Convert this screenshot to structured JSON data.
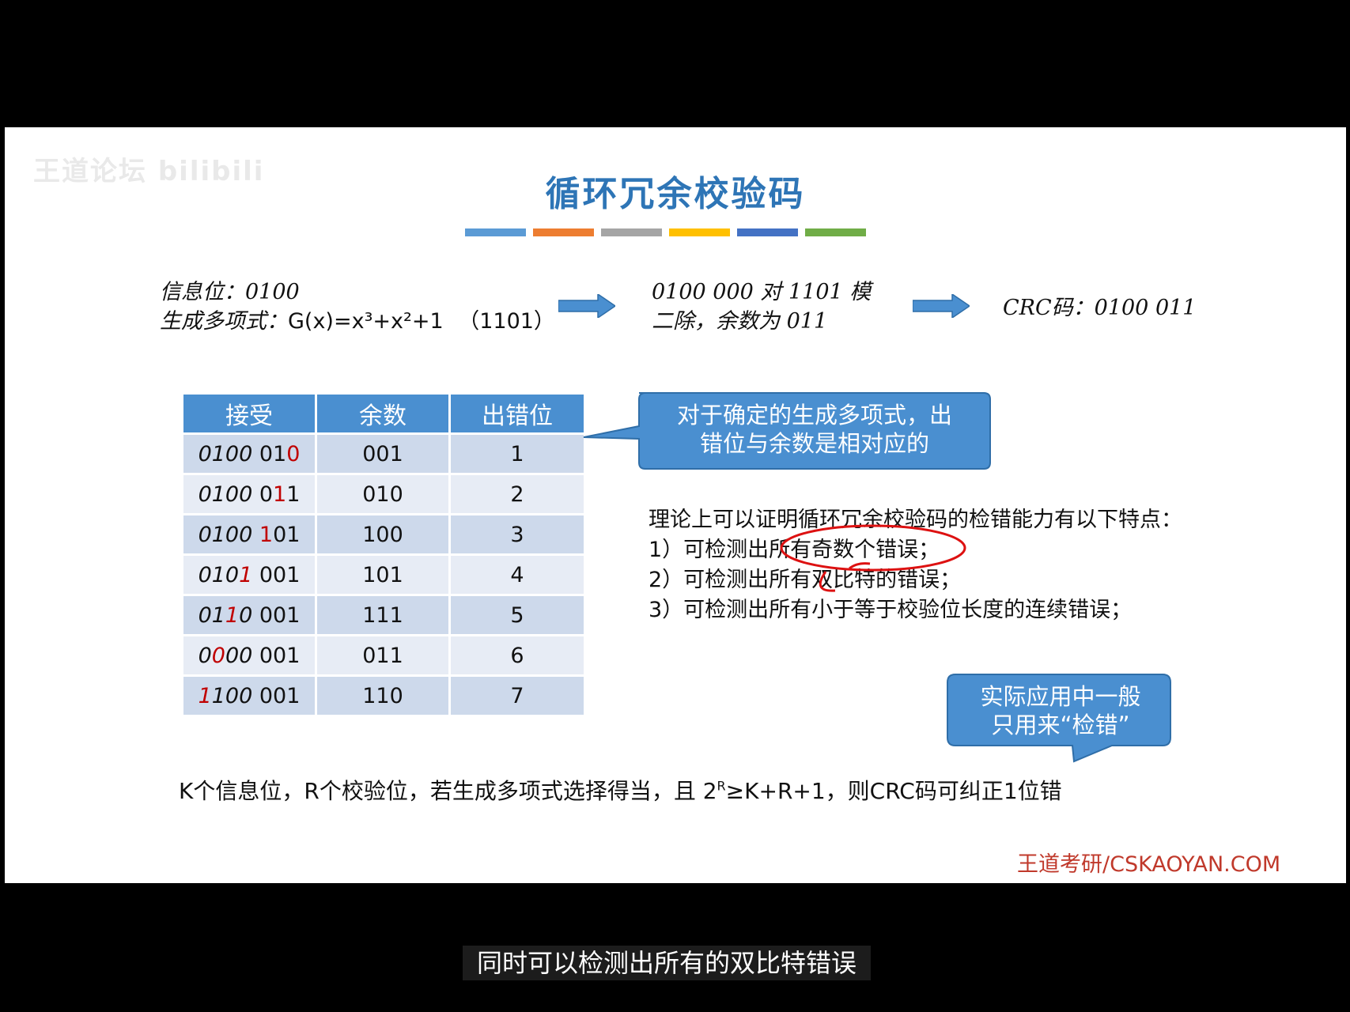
{
  "watermark": "王道论坛 bilibili",
  "slide": {
    "title": "循环冗余校验码",
    "colors": [
      "#5b9bd5",
      "#ed7d31",
      "#a5a5a5",
      "#ffc000",
      "#4472c4",
      "#70ad47"
    ],
    "intro": {
      "line1": "信息位：0100",
      "line2_prefix": "生成多项式：",
      "line2_poly": "G(x)=x³+x²+1",
      "line2_bits": "（1101）",
      "step2_line1": "0100 000 对 1101 模",
      "step2_line2": "二除，余数为 011",
      "result": "CRC码：0100 011"
    },
    "table": {
      "headers": [
        "接受",
        "余数",
        "出错位"
      ],
      "rows": [
        {
          "pre": "0100 ",
          "a": "01",
          "r": "0",
          "b": "",
          "remainder": "001",
          "pos": "1",
          "style": "tail"
        },
        {
          "pre": "0100 ",
          "a": "0",
          "r": "1",
          "b": "1",
          "remainder": "010",
          "pos": "2",
          "style": "tail"
        },
        {
          "pre": "0100 ",
          "a": "",
          "r": "1",
          "b": "01",
          "remainder": "100",
          "pos": "3",
          "style": "tail"
        },
        {
          "pre": "010",
          "a": "",
          "r": "1",
          "b": " 001",
          "remainder": "101",
          "pos": "4",
          "style": "head"
        },
        {
          "pre": "01",
          "a": "",
          "r": "1",
          "b": "0 001",
          "remainder": "111",
          "pos": "5",
          "style": "head"
        },
        {
          "pre": "0",
          "a": "",
          "r": "0",
          "b": "00 001",
          "remainder": "011",
          "pos": "6",
          "style": "head"
        },
        {
          "pre": "",
          "a": "",
          "r": "1",
          "b": "100 001",
          "remainder": "110",
          "pos": "7",
          "style": "head"
        }
      ]
    },
    "callout1": {
      "line1": "对于确定的生成多项式，出",
      "line2": "错位与余数是相对应的"
    },
    "theory": {
      "heading": "理论上可以证明循环冗余校验码的检错能力有以下特点：",
      "items": [
        "1）可检测出所有奇数个错误；",
        "2）可检测出所有双比特的错误；",
        "3）可检测出所有小于等于校验位长度的连续错误；"
      ]
    },
    "callout2": {
      "line1": "实际应用中一般",
      "line2": "只用来“检错”"
    },
    "bottom": {
      "text_a": "K个信息位，R个校验位，若生成多项式选择得当，且 2",
      "sup": "R",
      "text_b": "≥K+R+1，则CRC码可纠正1位错"
    },
    "brand": "王道考研/CSKAOYAN.COM"
  },
  "subtitle": "同时可以检测出所有的双比特错误"
}
